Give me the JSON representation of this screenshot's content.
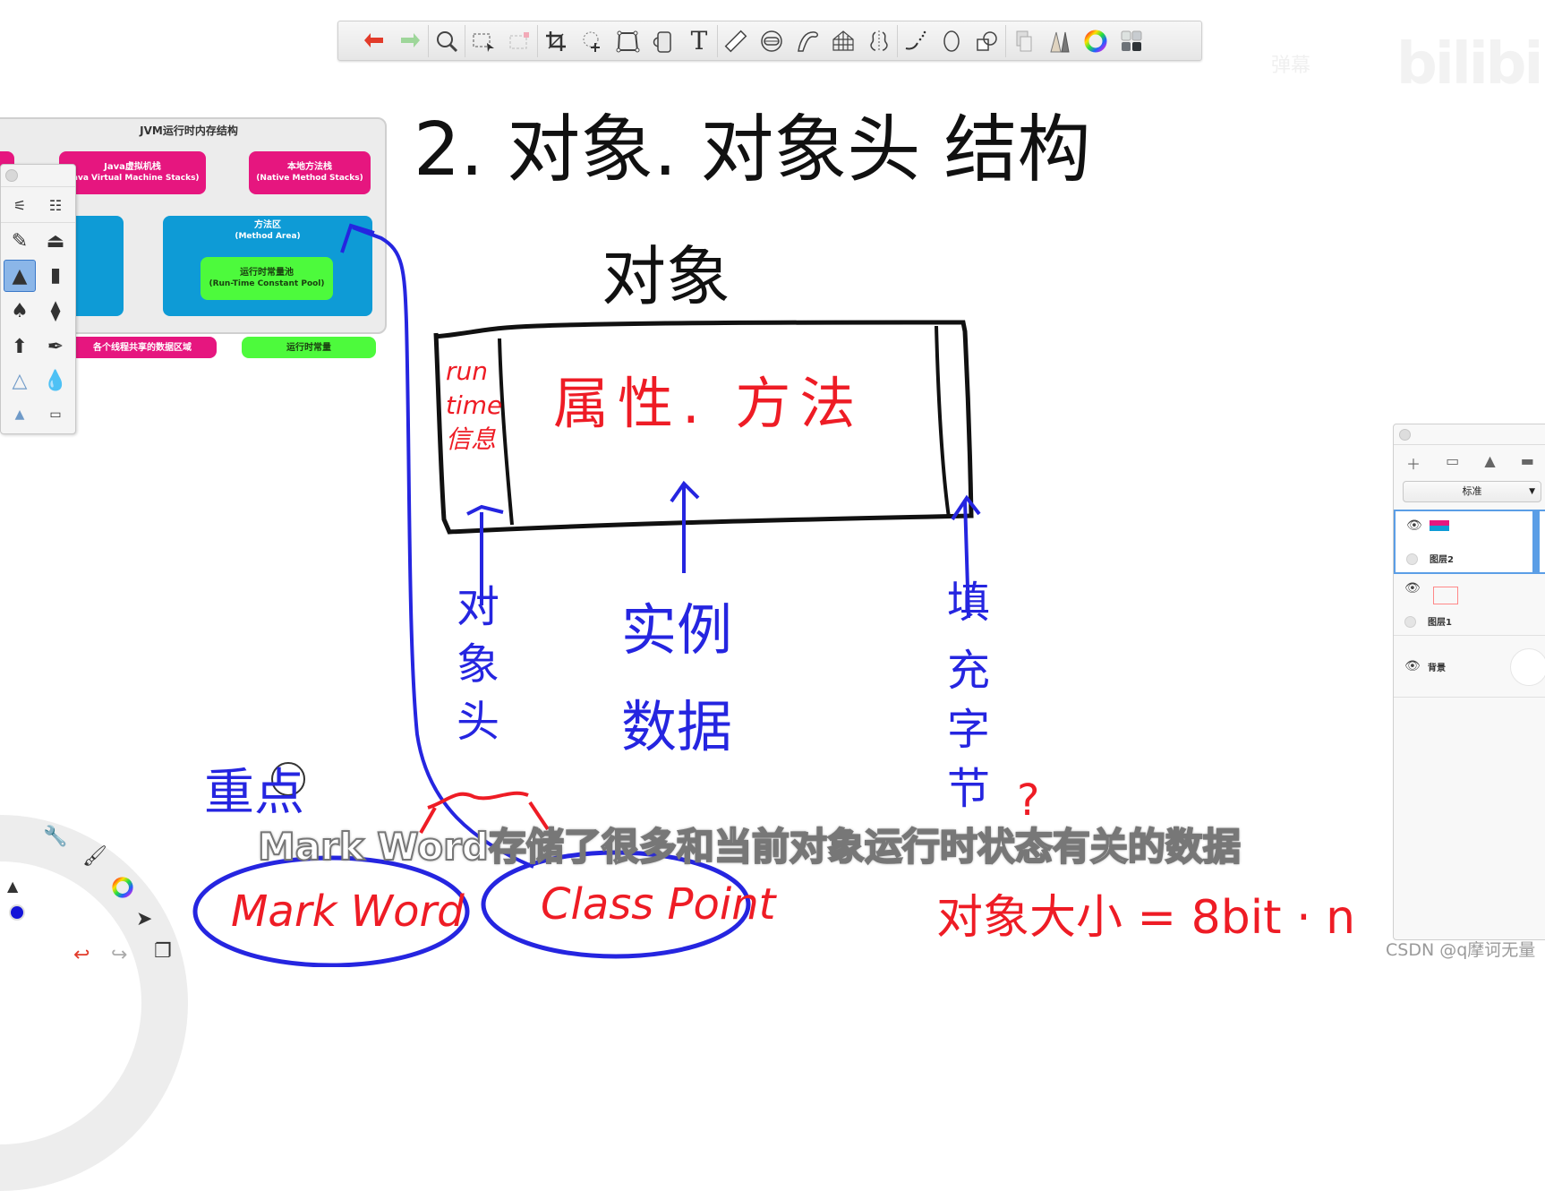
{
  "toolbar": {
    "tools": [
      {
        "name": "undo",
        "glyph": "↩"
      },
      {
        "name": "redo",
        "glyph": "↪"
      },
      {
        "name": "zoom",
        "glyph": "🔍"
      },
      {
        "name": "selection",
        "glyph": "⬚"
      },
      {
        "name": "clear-selection",
        "glyph": "⬚"
      },
      {
        "name": "crop",
        "glyph": "⌗"
      },
      {
        "name": "transform",
        "glyph": "✥"
      },
      {
        "name": "distort",
        "glyph": "▱"
      },
      {
        "name": "fill-bucket",
        "glyph": "▯"
      },
      {
        "name": "text",
        "glyph": "T"
      },
      {
        "name": "ruler",
        "glyph": "📏"
      },
      {
        "name": "ellipse-guide",
        "glyph": "⊜"
      },
      {
        "name": "french-curve",
        "glyph": "∽"
      },
      {
        "name": "perspective-guide",
        "glyph": "⌂"
      },
      {
        "name": "symmetry",
        "glyph": "⁞"
      },
      {
        "name": "steady-stroke",
        "glyph": "⌣"
      },
      {
        "name": "ellipse",
        "glyph": "◯"
      },
      {
        "name": "shapes",
        "glyph": "⧉"
      },
      {
        "name": "layers",
        "glyph": "❐"
      },
      {
        "name": "brushes",
        "glyph": "▲"
      },
      {
        "name": "color-wheel",
        "glyph": "◯"
      },
      {
        "name": "swatches",
        "glyph": "▦"
      }
    ]
  },
  "watermark": {
    "text": "bilibili",
    "small": "弹幕"
  },
  "jvm_diagram": {
    "title": "JVM运行时内存结构",
    "jvm_stack": {
      "zh": "Java虚拟机栈",
      "en": "(Java Virtual Machine Stacks)"
    },
    "native_stack": {
      "zh": "本地方法栈",
      "en": "(Native Method Stacks)"
    },
    "method_area": {
      "zh": "方法区",
      "en": "(Method Area)"
    },
    "constant_pool": {
      "zh": "运行时常量池",
      "en": "(Run-Time Constant Pool)"
    },
    "legend_shared": "各个线程共享的数据区域",
    "legend_constant": "运行时常量"
  },
  "notes": {
    "title": "2. 对象. 对象头 结构",
    "object_label": "对象",
    "runtime_info": [
      "run",
      "time",
      "信息"
    ],
    "fields_methods": "属性. 方法",
    "object_header": [
      "对",
      "象",
      "头"
    ],
    "instance_data": [
      "实例",
      "数据"
    ],
    "padding": [
      "填",
      "充",
      "字",
      "节"
    ],
    "question": "?",
    "important": "重点",
    "mark_word": "Mark Word",
    "class_point": "Class Point",
    "size_formula": "对象大小 = 8bit · n"
  },
  "subtitle": "Mark Word存储了很多和当前对象运行时状态有关的数据",
  "layers_panel": {
    "blend_mode": "标准",
    "layers": [
      {
        "name": "图层2",
        "selected": true
      },
      {
        "name": "图层1",
        "selected": false
      },
      {
        "name": "背景",
        "selected": false
      }
    ]
  },
  "credit": "CSDN @q摩诃无量",
  "colors": {
    "red_ink": "#ee1c25",
    "blue_ink": "#2525e0",
    "pink": "#e6167f",
    "blue_block": "#0e9bd6",
    "green_block": "#4dfa3c"
  }
}
